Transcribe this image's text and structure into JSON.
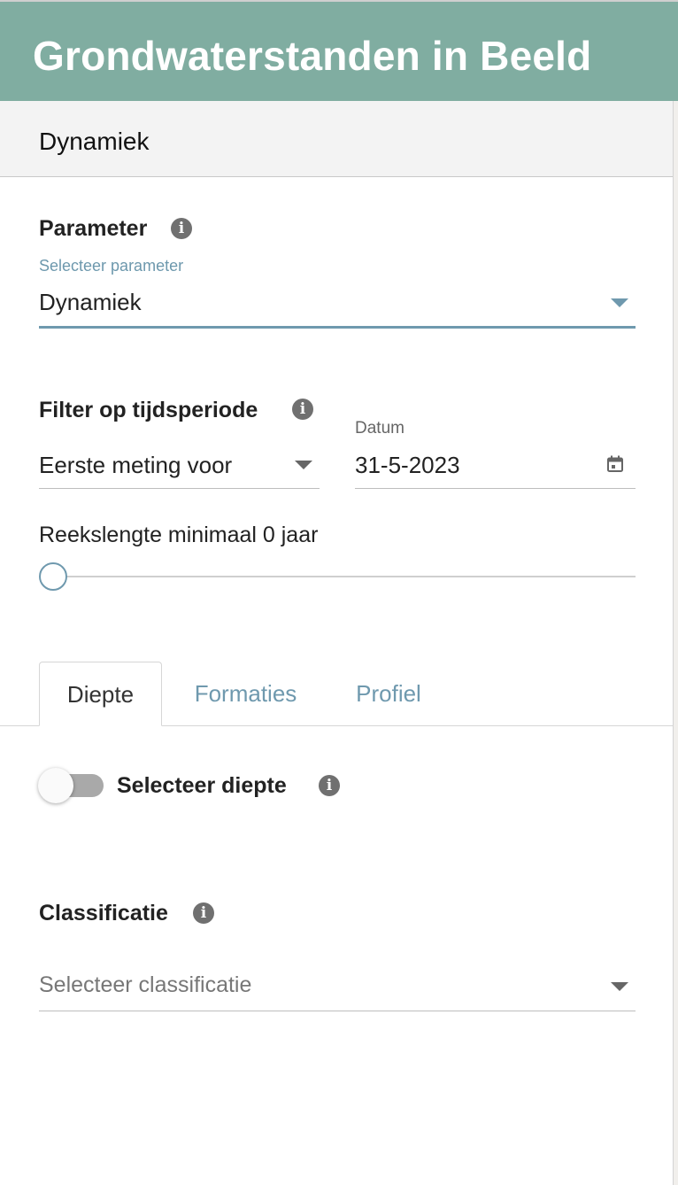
{
  "app": {
    "title": "Grondwaterstanden in Beeld"
  },
  "section": {
    "title": "Dynamiek"
  },
  "parameter": {
    "label": "Parameter",
    "field_label": "Selecteer parameter",
    "value": "Dynamiek"
  },
  "filter": {
    "label": "Filter op tijdsperiode",
    "mode_value": "Eerste meting voor",
    "date_label": "Datum",
    "date_value": "31-5-2023"
  },
  "series_length": {
    "label": "Reekslengte minimaal 0 jaar",
    "value_years": 0
  },
  "tabs": [
    {
      "label": "Diepte",
      "active": true
    },
    {
      "label": "Formaties",
      "active": false
    },
    {
      "label": "Profiel",
      "active": false
    }
  ],
  "depth": {
    "toggle_label": "Selecteer diepte",
    "toggle_on": false
  },
  "classification": {
    "label": "Classificatie",
    "placeholder": "Selecteer classificatie"
  },
  "colors": {
    "header_bg": "#80ada1",
    "accent": "#6f99ae",
    "info_icon": "#707070"
  },
  "icons": {
    "info": "info-icon",
    "dropdown": "caret-down-icon",
    "calendar": "calendar-icon"
  }
}
